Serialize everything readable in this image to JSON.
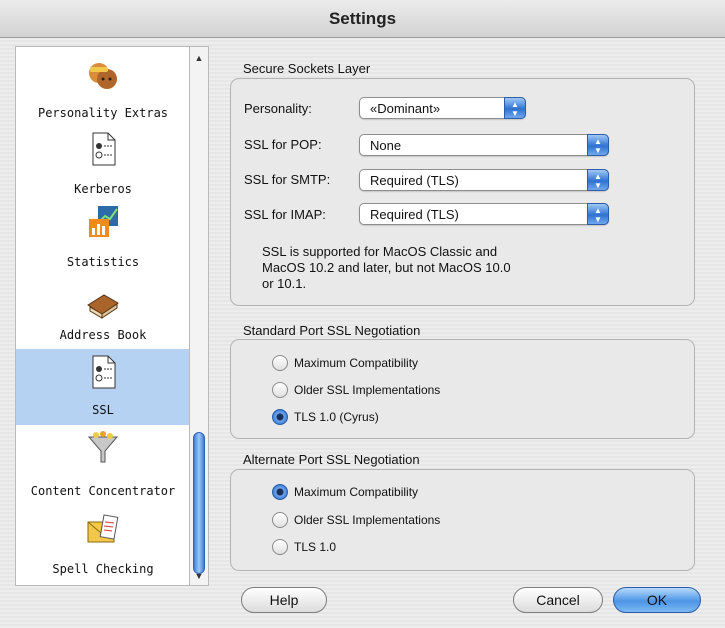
{
  "window": {
    "title": "Settings"
  },
  "sidebar": {
    "items": [
      {
        "label": "Personality Extras",
        "icon": "faces-icon"
      },
      {
        "label": "Kerberos",
        "icon": "document-icon"
      },
      {
        "label": "Statistics",
        "icon": "chart-icon"
      },
      {
        "label": "Address Book",
        "icon": "book-icon"
      },
      {
        "label": "SSL",
        "icon": "document-icon",
        "selected": true
      },
      {
        "label": "Content Concentrator",
        "icon": "funnel-icon"
      },
      {
        "label": "Spell Checking",
        "icon": "envelope-icon"
      }
    ]
  },
  "ssl_group": {
    "title": "Secure Sockets Layer",
    "fields": [
      {
        "label": "Personality:",
        "value": "«Dominant»"
      },
      {
        "label": "SSL for POP:",
        "value": "None"
      },
      {
        "label": "SSL for SMTP:",
        "value": "Required (TLS)"
      },
      {
        "label": "SSL for IMAP:",
        "value": "Required (TLS)"
      }
    ],
    "note_line1": "SSL is supported for MacOS Classic and",
    "note_line2": "MacOS 10.2 and later, but not MacOS 10.0",
    "note_line3": "or 10.1."
  },
  "standard_port": {
    "title": "Standard Port SSL Negotiation",
    "options": [
      "Maximum Compatibility",
      "Older SSL Implementations",
      "TLS 1.0 (Cyrus)"
    ],
    "selected_index": 2
  },
  "alternate_port": {
    "title": "Alternate Port SSL Negotiation",
    "options": [
      "Maximum Compatibility",
      "Older SSL Implementations",
      "TLS 1.0"
    ],
    "selected_index": 0
  },
  "buttons": {
    "help": "Help",
    "cancel": "Cancel",
    "ok": "OK"
  },
  "colors": {
    "accent": "#2f72d2",
    "selection": "#b6d2f2"
  }
}
